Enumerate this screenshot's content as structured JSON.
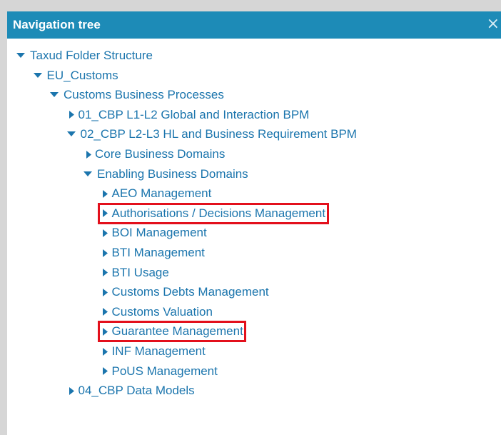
{
  "panel": {
    "title": "Navigation tree",
    "close_icon": "×"
  },
  "tree": [
    {
      "label": "Taxud Folder Structure",
      "expanded": true,
      "level": 0
    },
    {
      "label": "EU_Customs",
      "expanded": true,
      "level": 1
    },
    {
      "label": "Customs Business Processes",
      "expanded": true,
      "level": 2
    },
    {
      "label": "01_CBP L1-L2 Global and Interaction BPM",
      "expanded": false,
      "level": 3
    },
    {
      "label": "02_CBP L2-L3 HL and Business Requirement BPM",
      "expanded": true,
      "level": 3
    },
    {
      "label": "Core Business Domains",
      "expanded": false,
      "level": 4
    },
    {
      "label": "Enabling Business Domains",
      "expanded": true,
      "level": 4
    },
    {
      "label": "AEO Management",
      "expanded": false,
      "level": 5
    },
    {
      "label": "Authorisations / Decisions Management",
      "expanded": false,
      "level": 5,
      "highlighted": true
    },
    {
      "label": "BOI Management",
      "expanded": false,
      "level": 5
    },
    {
      "label": "BTI Management",
      "expanded": false,
      "level": 5
    },
    {
      "label": "BTI Usage",
      "expanded": false,
      "level": 5
    },
    {
      "label": "Customs Debts Management",
      "expanded": false,
      "level": 5
    },
    {
      "label": "Customs Valuation",
      "expanded": false,
      "level": 5
    },
    {
      "label": "Guarantee Management",
      "expanded": false,
      "level": 5,
      "highlighted": true
    },
    {
      "label": "INF Management",
      "expanded": false,
      "level": 5
    },
    {
      "label": "PoUS Management",
      "expanded": false,
      "level": 5
    },
    {
      "label": "04_CBP Data Models",
      "expanded": false,
      "level": 3
    }
  ],
  "colors": {
    "header_bg": "#1d8bb7",
    "link": "#1b75ad",
    "highlight_border": "#e3101c",
    "frame": "#d6d6d6"
  }
}
